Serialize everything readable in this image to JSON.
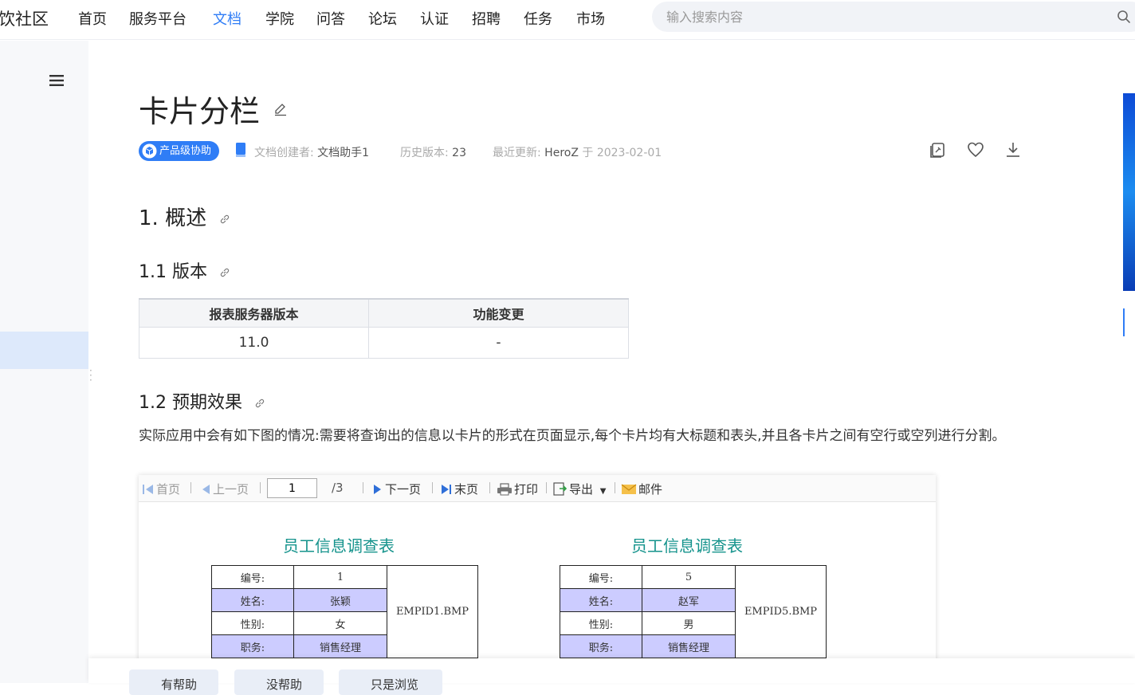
{
  "brand": "饮社区",
  "nav": [
    {
      "label": "首页"
    },
    {
      "label": "服务平台"
    },
    {
      "label": "文档",
      "active": true
    },
    {
      "label": "学院"
    },
    {
      "label": "问答"
    },
    {
      "label": "论坛"
    },
    {
      "label": "认证"
    },
    {
      "label": "招聘"
    },
    {
      "label": "任务"
    },
    {
      "label": "市场"
    }
  ],
  "search": {
    "placeholder": "输入搜索内容"
  },
  "page": {
    "title": "卡片分栏",
    "badge": "产品级协助",
    "creator_label": "文档创建者:",
    "creator": "文档助手1",
    "history_label": "历史版本:",
    "history": "23",
    "updated_label": "最近更新:",
    "updated_by": "HeroZ",
    "updated_on": "于 2023-02-01"
  },
  "sections": {
    "h1": "1. 概述",
    "h2_version": "1.1 版本",
    "h2_effect": "1.2 预期效果"
  },
  "version_table": {
    "headers": [
      "报表服务器版本",
      "功能变更"
    ],
    "rows": [
      [
        "11.0",
        "-"
      ]
    ]
  },
  "paragraph": "实际应用中会有如下图的情况:需要将查询出的信息以卡片的形式在页面显示,每个卡片均有大标题和表头,并且各卡片之间有空行或空列进行分割。",
  "report": {
    "toolbar": {
      "first": "首页",
      "prev": "上一页",
      "page_value": "1",
      "total": "/3",
      "next": "下一页",
      "last": "末页",
      "print": "打印",
      "export": "导出",
      "mail": "邮件"
    },
    "cards": [
      {
        "title": "员工信息调查表",
        "rows": [
          [
            "编号:",
            "1"
          ],
          [
            "姓名:",
            "张颖"
          ],
          [
            "性别:",
            "女"
          ],
          [
            "职务:",
            "销售经理"
          ]
        ],
        "photo": "EMPID1.BMP"
      },
      {
        "title": "员工信息调查表",
        "rows": [
          [
            "编号:",
            "5"
          ],
          [
            "姓名:",
            "赵军"
          ],
          [
            "性别:",
            "男"
          ],
          [
            "职务:",
            "销售经理"
          ]
        ],
        "photo": "EMPID5.BMP"
      }
    ]
  },
  "bottom_buttons": [
    "有帮助",
    "没帮助",
    "只是浏览"
  ],
  "colors": {
    "accent": "#2f7df6",
    "card_title": "#15938c",
    "card_highlight": "#ccccff"
  }
}
